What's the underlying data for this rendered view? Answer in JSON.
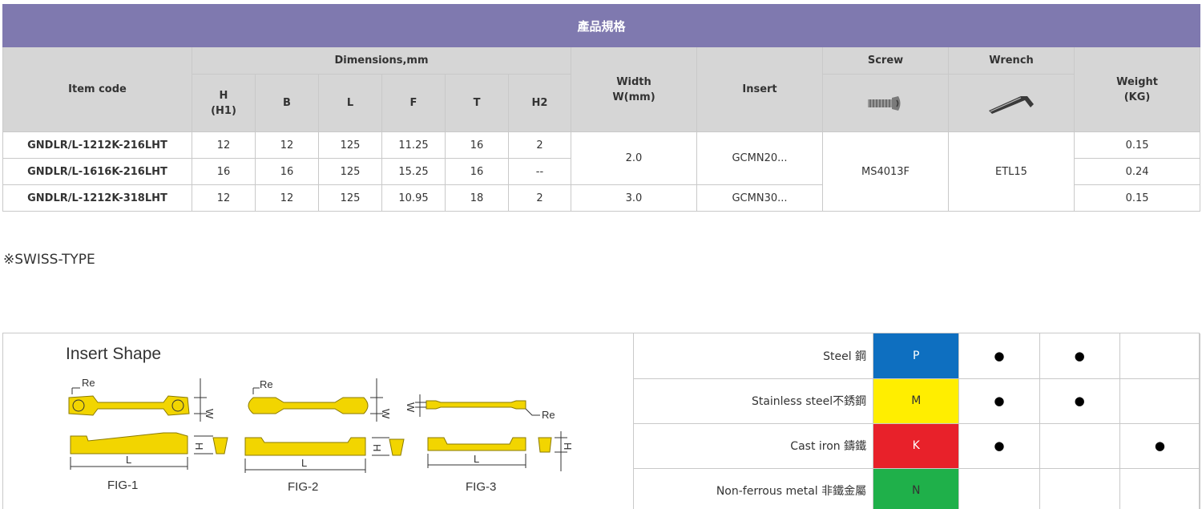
{
  "table": {
    "title": "產品規格",
    "headers": {
      "item_code": "Item code",
      "dimensions": "Dimensions,mm",
      "h": "H",
      "h_sub": "(H1)",
      "b": "B",
      "l": "L",
      "f": "F",
      "t": "T",
      "h2": "H2",
      "width": "Width",
      "width_sub": "W(mm)",
      "insert": "Insert",
      "screw": "Screw",
      "wrench": "Wrench",
      "weight": "Weight",
      "weight_sub": "(KG)"
    },
    "rows": [
      {
        "code": "GNDLR/L-1212K-216LHT",
        "h": "12",
        "b": "12",
        "l": "125",
        "f": "11.25",
        "t": "16",
        "h2": "2",
        "weight": "0.15"
      },
      {
        "code": "GNDLR/L-1616K-216LHT",
        "h": "16",
        "b": "16",
        "l": "125",
        "f": "15.25",
        "t": "16",
        "h2": "--",
        "weight": "0.24"
      },
      {
        "code": "GNDLR/L-1212K-318LHT",
        "h": "12",
        "b": "12",
        "l": "125",
        "f": "10.95",
        "t": "18",
        "h2": "2",
        "weight": "0.15"
      }
    ],
    "width_groups": [
      "2.0",
      "3.0"
    ],
    "insert_groups": [
      "GCMN20...",
      "GCMN30..."
    ],
    "screw_value": "MS4013F",
    "wrench_value": "ETL15",
    "icons": {
      "screw": "screw-icon",
      "wrench": "hex-wrench-icon"
    }
  },
  "swiss_note": "※SWISS-TYPE",
  "insert_shape": {
    "title": "Insert Shape",
    "figs": [
      "FIG-1",
      "FIG-2",
      "FIG-3"
    ],
    "dim_labels": {
      "re": "Re",
      "w": "W",
      "h": "H",
      "l": "L"
    },
    "insert_color": "#f2d500"
  },
  "materials": [
    {
      "name": "Steel 鋼",
      "grade": "P",
      "color": "#0e6fc0",
      "text_color": "#ffffff",
      "marks": [
        "●",
        "●",
        ""
      ]
    },
    {
      "name": "Stainless steel不銹鋼",
      "grade": "M",
      "color": "#ffee00",
      "text_color": "#333333",
      "marks": [
        "●",
        "●",
        ""
      ]
    },
    {
      "name": "Cast iron 鑄鐵",
      "grade": "K",
      "color": "#e8212a",
      "text_color": "#ffffff",
      "marks": [
        "●",
        "",
        "●"
      ]
    },
    {
      "name": "Non-ferrous metal 非鐵金屬",
      "grade": "N",
      "color": "#1fb04a",
      "text_color": "#333333",
      "marks": [
        "",
        "",
        ""
      ]
    }
  ]
}
